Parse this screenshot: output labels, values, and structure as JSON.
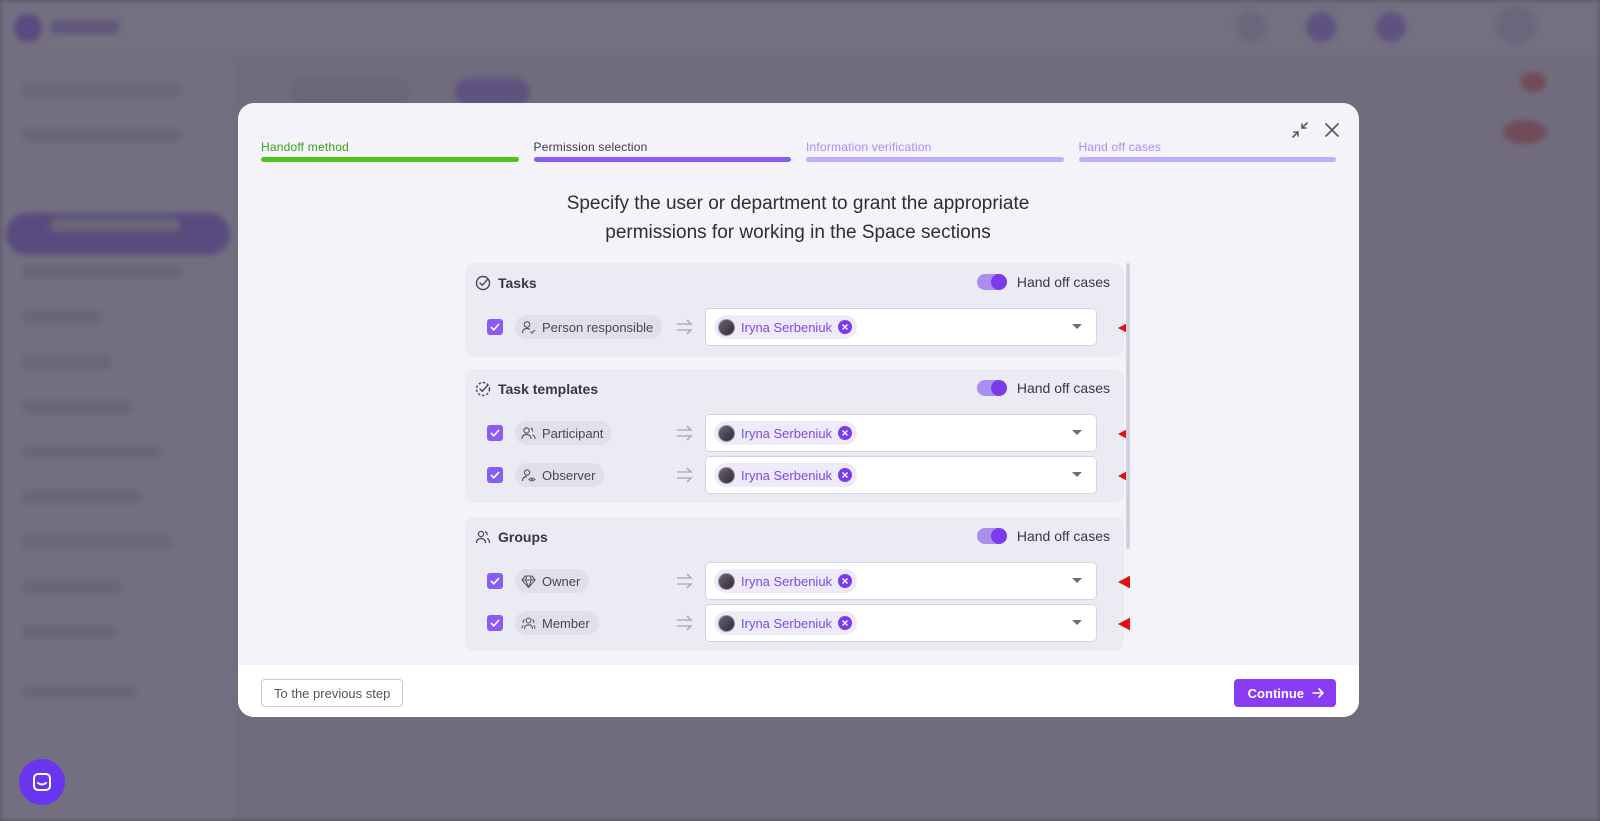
{
  "stepper": {
    "steps": [
      {
        "label": "Handoff method",
        "state": "done"
      },
      {
        "label": "Permission selection",
        "state": "active"
      },
      {
        "label": "Information verification",
        "state": "future"
      },
      {
        "label": "Hand off cases",
        "state": "future"
      }
    ]
  },
  "heading": "Specify the user or department to grant the appropriate permissions for working in the Space sections",
  "sections": [
    {
      "title": "Tasks",
      "icon": "check-circle-icon",
      "toggle_label": "Hand off cases",
      "toggle_on": true,
      "rows": [
        {
          "role": "Person responsible",
          "role_icon": "user-check-icon",
          "checked": true,
          "assignee": "Iryna Serbeniuk"
        }
      ]
    },
    {
      "title": "Task templates",
      "icon": "dashed-check-circle-icon",
      "toggle_label": "Hand off cases",
      "toggle_on": true,
      "rows": [
        {
          "role": "Participant",
          "role_icon": "users-icon",
          "checked": true,
          "assignee": "Iryna Serbeniuk"
        },
        {
          "role": "Observer",
          "role_icon": "user-eye-icon",
          "checked": true,
          "assignee": "Iryna Serbeniuk"
        }
      ]
    },
    {
      "title": "Groups",
      "icon": "group-icon",
      "toggle_label": "Hand off cases",
      "toggle_on": true,
      "rows": [
        {
          "role": "Owner",
          "role_icon": "diamond-icon",
          "checked": true,
          "assignee": "Iryna Serbeniuk"
        },
        {
          "role": "Member",
          "role_icon": "group-icon",
          "checked": true,
          "assignee": "Iryna Serbeniuk"
        }
      ]
    }
  ],
  "footer": {
    "prev_label": "To the previous step",
    "continue_label": "Continue"
  },
  "colors": {
    "accent": "#8a3cf5",
    "done": "#52c41a",
    "annotation_arrow": "#e01010"
  }
}
